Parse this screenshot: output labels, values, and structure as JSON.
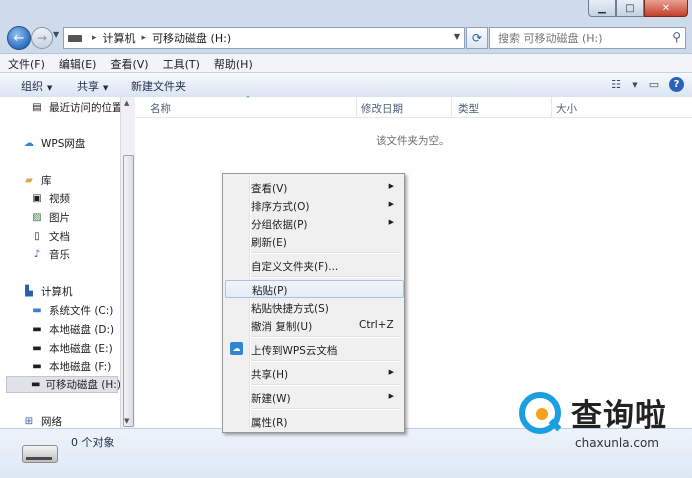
{
  "window": {
    "min_icon": "minimize-icon",
    "max_icon": "maximize-icon",
    "close_icon": "close-icon"
  },
  "address": {
    "segments": [
      "计算机",
      "可移动磁盘 (H:)"
    ],
    "search_placeholder": "搜索 可移动磁盘 (H:)"
  },
  "menubar": [
    "文件(F)",
    "编辑(E)",
    "查看(V)",
    "工具(T)",
    "帮助(H)"
  ],
  "toolbar": {
    "organize": "组织",
    "share": "共享",
    "new_folder": "新建文件夹"
  },
  "nav": {
    "recent": "最近访问的位置",
    "wps": "WPS网盘",
    "library": "库",
    "lib_items": [
      "视频",
      "图片",
      "文档",
      "音乐"
    ],
    "computer": "计算机",
    "drives": [
      "系统文件 (C:)",
      "本地磁盘 (D:)",
      "本地磁盘 (E:)",
      "本地磁盘 (F:)",
      "可移动磁盘 (H:)"
    ],
    "network": "网络"
  },
  "columns": [
    "名称",
    "修改日期",
    "类型",
    "大小"
  ],
  "empty_text": "该文件夹为空。",
  "status": {
    "count": "0 个对象"
  },
  "context_menu": {
    "view": "查看(V)",
    "sort": "排序方式(O)",
    "group": "分组依据(P)",
    "refresh": "刷新(E)",
    "customize": "自定义文件夹(F)...",
    "paste": "粘贴(P)",
    "paste_shortcut": "粘贴快捷方式(S)",
    "undo": "撤消 复制(U)",
    "undo_shortcut": "Ctrl+Z",
    "upload": "上传到WPS云文档",
    "share": "共享(H)",
    "new": "新建(W)",
    "properties": "属性(R)"
  },
  "watermark": {
    "title": "查询啦",
    "url": "chaxunla.com"
  },
  "colors": {
    "accent": "#2f6fbf",
    "menu_highlight": "#e2ebf7",
    "watermark_blue": "#1aa0e0",
    "watermark_orange": "#f2a31b"
  }
}
